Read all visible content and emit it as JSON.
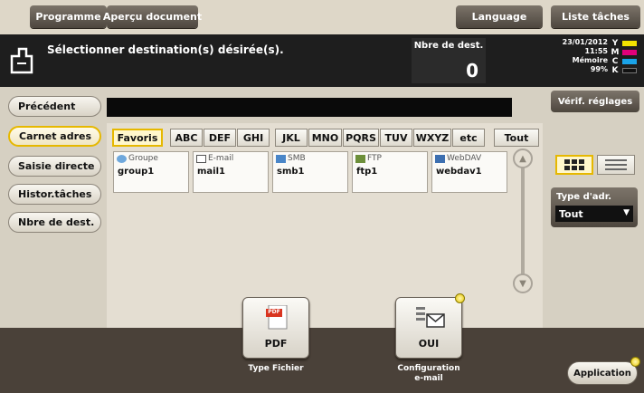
{
  "topbar": {
    "programme": "Programme",
    "apercu": "Aperçu document",
    "language": "Language",
    "liste_taches": "Liste tâches"
  },
  "status": {
    "message": "Sélectionner destination(s) désirée(s).",
    "dest_count_label": "Nbre de dest.",
    "dest_count_value": "0",
    "date": "23/01/2012",
    "time": "11:55",
    "memory_label": "Mémoire",
    "memory_value": "99%",
    "toner": [
      {
        "channel": "Y",
        "color": "#f2e200"
      },
      {
        "channel": "M",
        "color": "#e2007a"
      },
      {
        "channel": "C",
        "color": "#1aa3e8"
      },
      {
        "channel": "K",
        "color": "#1a1a1a"
      }
    ]
  },
  "sidebar": {
    "precedent": "Précédent",
    "items": [
      {
        "label": "Carnet adres",
        "active": true
      },
      {
        "label": "Saisie directe",
        "active": false
      },
      {
        "label": "Histor.tâches",
        "active": false
      },
      {
        "label": "Nbre de dest.",
        "active": false
      }
    ]
  },
  "verif_button": "Vérif. réglages",
  "tabs": [
    "Favoris",
    "ABC",
    "DEF",
    "GHI",
    "JKL",
    "MNO",
    "PQRS",
    "TUV",
    "WXYZ",
    "etc",
    "Tout"
  ],
  "active_tab": "Favoris",
  "destinations": [
    {
      "type": "Groupe",
      "name": "group1",
      "icon": "group-icon"
    },
    {
      "type": "E-mail",
      "name": "mail1",
      "icon": "email-icon"
    },
    {
      "type": "SMB",
      "name": "smb1",
      "icon": "smb-icon"
    },
    {
      "type": "FTP",
      "name": "ftp1",
      "icon": "ftp-icon"
    },
    {
      "type": "WebDAV",
      "name": "webdav1",
      "icon": "webdav-icon"
    }
  ],
  "address_type": {
    "label": "Type d'adr.",
    "value": "Tout"
  },
  "bottom": {
    "file_type_value": "PDF",
    "file_type_icon_text": "PDF",
    "file_type_caption": "Type Fichier",
    "email_config_value": "OUI",
    "email_config_caption_1": "Configuration",
    "email_config_caption_2": "e-mail",
    "application": "Application"
  },
  "colors": {
    "accent": "#e6b800",
    "dark_button": "#5b534a",
    "status_bg": "#1e1e1e"
  }
}
